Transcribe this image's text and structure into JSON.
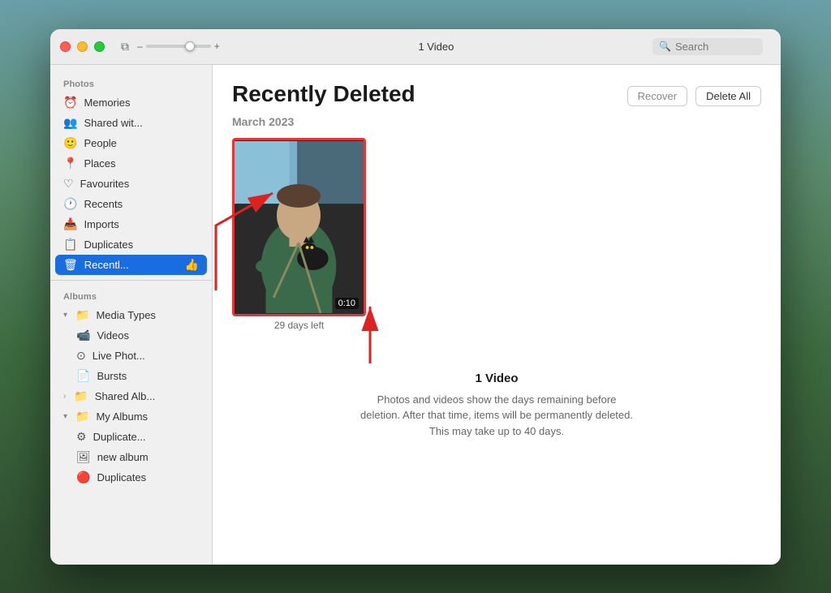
{
  "window": {
    "title": "Recently Deleted"
  },
  "titlebar": {
    "video_count": "1 Video",
    "search_placeholder": "Search",
    "zoom_minus": "–",
    "zoom_plus": "+"
  },
  "sidebar": {
    "photos_section": "Photos",
    "albums_section": "Albums",
    "items": [
      {
        "id": "memories",
        "label": "Memories",
        "icon": "⏰",
        "indent": 0
      },
      {
        "id": "shared",
        "label": "Shared wit...",
        "icon": "👥",
        "indent": 0
      },
      {
        "id": "people",
        "label": "People",
        "icon": "🙂",
        "indent": 0
      },
      {
        "id": "places",
        "label": "Places",
        "icon": "📍",
        "indent": 0
      },
      {
        "id": "favourites",
        "label": "Favourites",
        "icon": "♡",
        "indent": 0
      },
      {
        "id": "recents",
        "label": "Recents",
        "icon": "🕐",
        "indent": 0
      },
      {
        "id": "imports",
        "label": "Imports",
        "icon": "📥",
        "indent": 0
      },
      {
        "id": "duplicates",
        "label": "Duplicates",
        "icon": "📋",
        "indent": 0
      },
      {
        "id": "recently-deleted",
        "label": "Recentl...",
        "icon": "🗑",
        "indent": 0,
        "active": true
      }
    ],
    "album_items": [
      {
        "id": "media-types",
        "label": "Media Types",
        "icon": "📁",
        "indent": 0,
        "expandable": true,
        "expanded": true
      },
      {
        "id": "videos",
        "label": "Videos",
        "icon": "📹",
        "indent": 1
      },
      {
        "id": "live-photos",
        "label": "Live Phot...",
        "icon": "⊙",
        "indent": 1
      },
      {
        "id": "bursts",
        "label": "Bursts",
        "icon": "📄",
        "indent": 1
      },
      {
        "id": "shared-albums",
        "label": "Shared Alb...",
        "icon": "📁",
        "indent": 0,
        "expandable": true
      },
      {
        "id": "my-albums",
        "label": "My Albums",
        "icon": "📁",
        "indent": 0,
        "expandable": true,
        "expanded": true
      },
      {
        "id": "duplicates2",
        "label": "Duplicate...",
        "icon": "⚙",
        "indent": 1
      },
      {
        "id": "new-album",
        "label": "new album",
        "icon": "🖼",
        "indent": 1
      },
      {
        "id": "duplicates3",
        "label": "Duplicates",
        "icon": "🔴",
        "indent": 1
      }
    ]
  },
  "content": {
    "title": "Recently Deleted",
    "recover_label": "Recover",
    "delete_all_label": "Delete All",
    "section_date": "March 2023",
    "video_item": {
      "duration": "0:10",
      "days_left": "29 days left"
    },
    "info": {
      "video_count": "1 Video",
      "description": "Photos and videos show the days remaining before deletion. After that time, items will be permanently deleted. This may take up to 40 days."
    }
  }
}
